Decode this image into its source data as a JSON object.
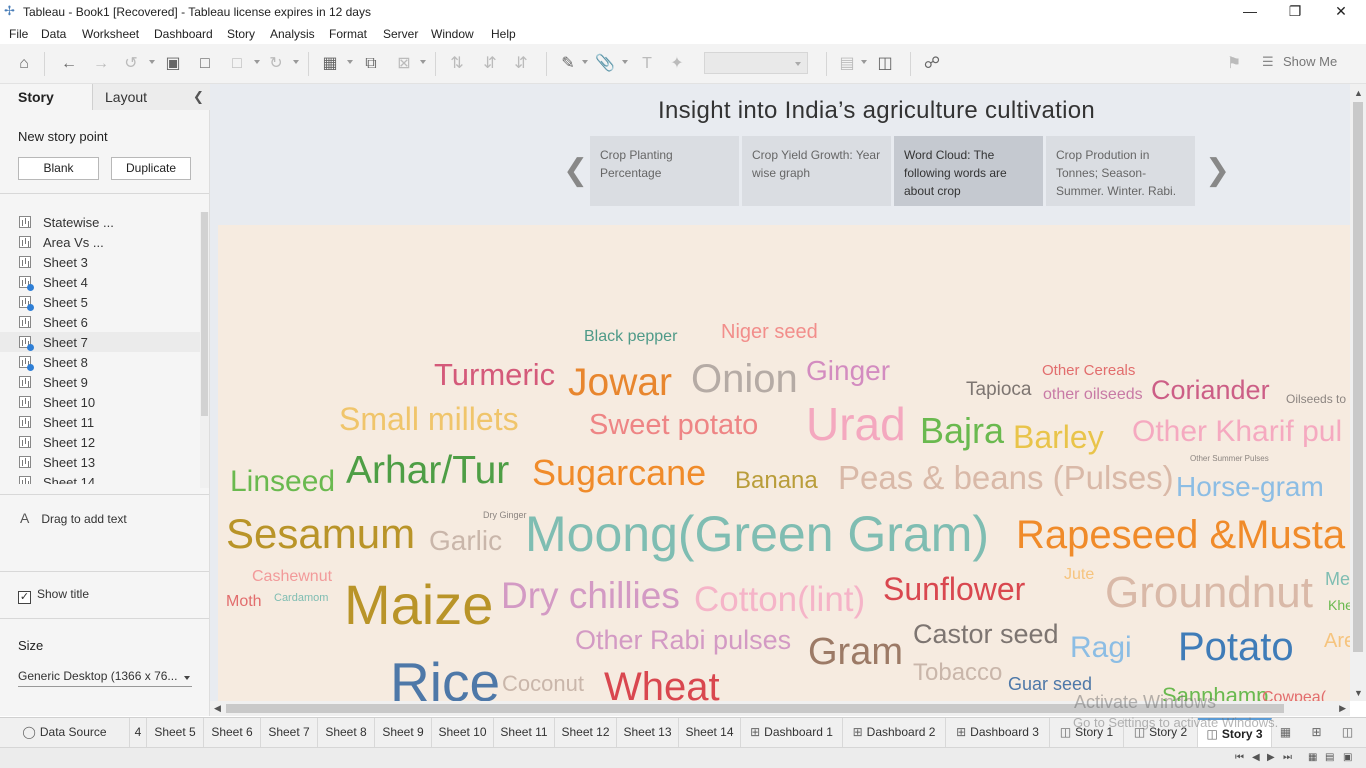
{
  "window": {
    "title": "Tableau - Book1 [Recovered] - Tableau license expires in 12 days",
    "app_icon": "tableau-logo-icon",
    "controls": [
      "minimize-icon",
      "restore-icon",
      "close-icon"
    ]
  },
  "menu": [
    "File",
    "Data",
    "Worksheet",
    "Dashboard",
    "Story",
    "Analysis",
    "Format",
    "Server",
    "Window",
    "Help"
  ],
  "toolbar": {
    "show_me_label": "Show Me",
    "fit_value": ""
  },
  "left_pane": {
    "tabs": {
      "story": "Story",
      "layout": "Layout"
    },
    "new_story_point": "New story point",
    "blank_button": "Blank",
    "duplicate_button": "Duplicate",
    "sheets": [
      {
        "label": "Statewise ...",
        "used": false
      },
      {
        "label": "Area Vs ...",
        "used": false
      },
      {
        "label": "Sheet 3",
        "used": false
      },
      {
        "label": "Sheet 4",
        "used": true
      },
      {
        "label": "Sheet 5",
        "used": true
      },
      {
        "label": "Sheet 6",
        "used": false
      },
      {
        "label": "Sheet 7",
        "used": true
      },
      {
        "label": "Sheet 8",
        "used": true
      },
      {
        "label": "Sheet 9",
        "used": false
      },
      {
        "label": "Sheet 10",
        "used": false
      },
      {
        "label": "Sheet 11",
        "used": false
      },
      {
        "label": "Sheet 12",
        "used": false
      },
      {
        "label": "Sheet 13",
        "used": false
      },
      {
        "label": "Sheet 14",
        "used": false
      }
    ],
    "drag_text": "Drag to add text",
    "show_title": "Show title",
    "show_title_checked": true,
    "size_header": "Size",
    "size_value": "Generic Desktop (1366 x 76..."
  },
  "story": {
    "title": "Insight into India’s agriculture cultivation",
    "points": [
      {
        "text": "Crop Planting Percentage",
        "active": false
      },
      {
        "text": "Crop Yield Growth: Year wise graph",
        "active": false
      },
      {
        "text": "Word Cloud: The following words are about crop",
        "active": true
      },
      {
        "text": "Crop Prodution in Tonnes; Season- Summer. Winter. Rabi.",
        "active": false
      }
    ]
  },
  "word_cloud": [
    {
      "text": "Black pepper",
      "color": "#4e9a88"
    },
    {
      "text": "Niger seed",
      "color": "#f28e8b"
    },
    {
      "text": "Turmeric",
      "color": "#d45a7a"
    },
    {
      "text": "Jowar",
      "color": "#e8862e"
    },
    {
      "text": "Onion",
      "color": "#b5aba5"
    },
    {
      "text": "Ginger",
      "color": "#d38cc0"
    },
    {
      "text": "Tapioca",
      "color": "#7d7571"
    },
    {
      "text": "Other Cereals",
      "color": "#e26d6d"
    },
    {
      "text": "other oilseeds",
      "color": "#c87aa5"
    },
    {
      "text": "Coriander",
      "color": "#cc5e86"
    },
    {
      "text": "Oilseeds to",
      "color": "#8c8581"
    },
    {
      "text": "Small millets",
      "color": "#f0c56b"
    },
    {
      "text": "Sweet potato",
      "color": "#ee8585"
    },
    {
      "text": "Urad",
      "color": "#f4a8bf"
    },
    {
      "text": "Bajra",
      "color": "#6ab94f"
    },
    {
      "text": "Barley",
      "color": "#e9c44a"
    },
    {
      "text": "Other Kharif pul",
      "color": "#f5a9c0"
    },
    {
      "text": "Linseed",
      "color": "#6ab94f"
    },
    {
      "text": "Arhar/Tur",
      "color": "#4e9e45"
    },
    {
      "text": "Sugarcane",
      "color": "#f08b2a"
    },
    {
      "text": "Banana",
      "color": "#b99d3a"
    },
    {
      "text": "Peas & beans (Pulses)",
      "color": "#d9b9a8"
    },
    {
      "text": "Other Summer Pulses",
      "color": "#8c8581"
    },
    {
      "text": "Horse-gram",
      "color": "#8cbde4"
    },
    {
      "text": "Dry Ginger",
      "color": "#8c8581"
    },
    {
      "text": "Sesamum",
      "color": "#b99428"
    },
    {
      "text": "Garlic",
      "color": "#c9b6aa"
    },
    {
      "text": "Moong(Green Gram)",
      "color": "#7fbdb2"
    },
    {
      "text": "Rapeseed &Musta",
      "color": "#f08b2a"
    },
    {
      "text": "Cashewnut",
      "color": "#f29a9a"
    },
    {
      "text": "Jute",
      "color": "#f6c47e"
    },
    {
      "text": "Moth",
      "color": "#e26d6d"
    },
    {
      "text": "Cardamom",
      "color": "#7fbdb2"
    },
    {
      "text": "Maize",
      "color": "#b99428"
    },
    {
      "text": "Dry chillies",
      "color": "#d39ac4"
    },
    {
      "text": "Cotton(lint)",
      "color": "#f5b4c8"
    },
    {
      "text": "Sunflower",
      "color": "#d9474f"
    },
    {
      "text": "Groundnut",
      "color": "#d9b9a8"
    },
    {
      "text": "Me",
      "color": "#7fbdb2"
    },
    {
      "text": "Khe",
      "color": "#6ab94f"
    },
    {
      "text": "Other Rabi pulses",
      "color": "#d39ac4"
    },
    {
      "text": "Gram",
      "color": "#9c7a66"
    },
    {
      "text": "Castor seed",
      "color": "#7d7571"
    },
    {
      "text": "Ragi",
      "color": "#8cbde4"
    },
    {
      "text": "Potato",
      "color": "#3f7cb8"
    },
    {
      "text": "Areca",
      "color": "#f6c47e"
    },
    {
      "text": "Tobacco",
      "color": "#c9b6aa"
    },
    {
      "text": "Coconut",
      "color": "#c9b6aa"
    },
    {
      "text": "Rice",
      "color": "#4e78a8"
    },
    {
      "text": "Wheat",
      "color": "#d9474f"
    },
    {
      "text": "Guar seed",
      "color": "#4e78a8"
    },
    {
      "text": "Sannhamp",
      "color": "#6ab94f"
    },
    {
      "text": "Cowpea(",
      "color": "#e26d6d"
    }
  ],
  "bottom_tabs": [
    {
      "label": "Data Source",
      "icon": "database-icon",
      "active": false
    },
    {
      "label": "4",
      "icon": "",
      "active": false
    },
    {
      "label": "Sheet 5",
      "icon": "",
      "active": false
    },
    {
      "label": "Sheet 6",
      "icon": "",
      "active": false
    },
    {
      "label": "Sheet 7",
      "icon": "",
      "active": false
    },
    {
      "label": "Sheet 8",
      "icon": "",
      "active": false
    },
    {
      "label": "Sheet 9",
      "icon": "",
      "active": false
    },
    {
      "label": "Sheet 10",
      "icon": "",
      "active": false
    },
    {
      "label": "Sheet 11",
      "icon": "",
      "active": false
    },
    {
      "label": "Sheet 12",
      "icon": "",
      "active": false
    },
    {
      "label": "Sheet 13",
      "icon": "",
      "active": false
    },
    {
      "label": "Sheet 14",
      "icon": "",
      "active": false
    },
    {
      "label": "Dashboard 1",
      "icon": "dashboard-icon",
      "active": false
    },
    {
      "label": "Dashboard 2",
      "icon": "dashboard-icon",
      "active": false
    },
    {
      "label": "Dashboard 3",
      "icon": "dashboard-icon",
      "active": false
    },
    {
      "label": "Story 1",
      "icon": "story-icon",
      "active": false
    },
    {
      "label": "Story 2",
      "icon": "story-icon",
      "active": false
    },
    {
      "label": "Story 3",
      "icon": "story-icon",
      "active": true
    }
  ],
  "watermark": {
    "line1": "Activate Windows",
    "line2": "Go to Settings to activate Windows."
  }
}
